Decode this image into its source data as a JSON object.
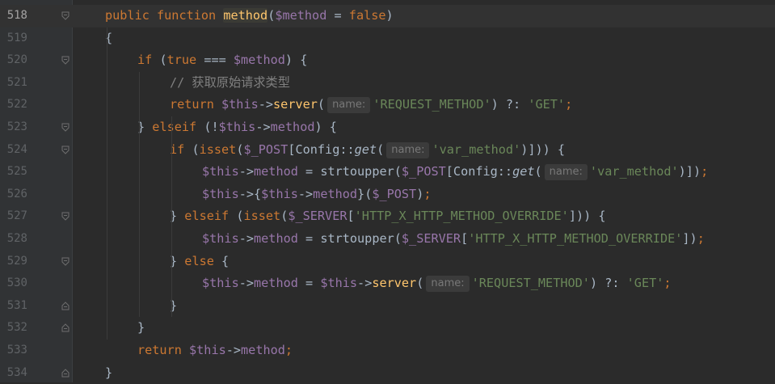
{
  "colors": {
    "background": "#2b2b2b",
    "gutter": "#313335",
    "keyword": "#cc7832",
    "function": "#ffc66d",
    "variable": "#9876aa",
    "string": "#6a8759",
    "comment": "#808080",
    "plain": "#a9b7c6"
  },
  "lines": [
    {
      "num": "518",
      "current": true,
      "fold": "open",
      "tokens": [
        [
          "kw",
          "public "
        ],
        [
          "kw",
          "function "
        ],
        [
          "fn-hl",
          "method"
        ],
        [
          "punct",
          "("
        ],
        [
          "var",
          "$method"
        ],
        [
          "punct",
          " = "
        ],
        [
          "kw",
          "false"
        ],
        [
          "punct",
          ")"
        ]
      ]
    },
    {
      "num": "519",
      "fold": "",
      "tokens": [
        [
          "punct",
          "{"
        ]
      ]
    },
    {
      "num": "520",
      "fold": "open",
      "tokens": [
        [
          "kw",
          "if "
        ],
        [
          "punct",
          "("
        ],
        [
          "kw",
          "true"
        ],
        [
          "punct",
          " === "
        ],
        [
          "var",
          "$method"
        ],
        [
          "punct",
          ") {"
        ]
      ]
    },
    {
      "num": "521",
      "fold": "",
      "tokens": [
        [
          "cmt",
          "// 获取原始请求类型"
        ]
      ]
    },
    {
      "num": "522",
      "fold": "",
      "tokens": [
        [
          "kw",
          "return "
        ],
        [
          "var",
          "$this"
        ],
        [
          "punct",
          "->"
        ],
        [
          "fn",
          "server"
        ],
        [
          "punct",
          "("
        ],
        [
          "hint",
          "name:"
        ],
        [
          "str",
          "'REQUEST_METHOD'"
        ],
        [
          "punct",
          ") ?: "
        ],
        [
          "str",
          "'GET'"
        ],
        [
          "kw",
          ";"
        ]
      ]
    },
    {
      "num": "523",
      "fold": "open",
      "tokens": [
        [
          "punct",
          "} "
        ],
        [
          "kw",
          "elseif "
        ],
        [
          "punct",
          "(!"
        ],
        [
          "var",
          "$this"
        ],
        [
          "punct",
          "->"
        ],
        [
          "var",
          "method"
        ],
        [
          "punct",
          ") {"
        ]
      ]
    },
    {
      "num": "524",
      "fold": "open",
      "tokens": [
        [
          "kw",
          "if "
        ],
        [
          "punct",
          "("
        ],
        [
          "kw",
          "isset"
        ],
        [
          "punct",
          "("
        ],
        [
          "var",
          "$_POST"
        ],
        [
          "punct",
          "[Config::"
        ],
        [
          "ital",
          "get"
        ],
        [
          "punct",
          "("
        ],
        [
          "hint",
          "name:"
        ],
        [
          "str",
          "'var_method'"
        ],
        [
          "punct",
          ")])) {"
        ]
      ]
    },
    {
      "num": "525",
      "fold": "",
      "tokens": [
        [
          "var",
          "$this"
        ],
        [
          "punct",
          "->"
        ],
        [
          "var",
          "method"
        ],
        [
          "punct",
          " = strtoupper("
        ],
        [
          "var",
          "$_POST"
        ],
        [
          "punct",
          "[Config::"
        ],
        [
          "ital",
          "get"
        ],
        [
          "punct",
          "("
        ],
        [
          "hint",
          "name:"
        ],
        [
          "str",
          "'var_method'"
        ],
        [
          "punct",
          ")])"
        ],
        [
          "kw",
          ";"
        ]
      ]
    },
    {
      "num": "526",
      "fold": "",
      "tokens": [
        [
          "var",
          "$this"
        ],
        [
          "punct",
          "->{"
        ],
        [
          "var",
          "$this"
        ],
        [
          "punct",
          "->"
        ],
        [
          "var",
          "method"
        ],
        [
          "punct",
          "}("
        ],
        [
          "var",
          "$_POST"
        ],
        [
          "punct",
          ")"
        ],
        [
          "kw",
          ";"
        ]
      ]
    },
    {
      "num": "527",
      "fold": "open",
      "tokens": [
        [
          "punct",
          "} "
        ],
        [
          "kw",
          "elseif "
        ],
        [
          "punct",
          "("
        ],
        [
          "kw",
          "isset"
        ],
        [
          "punct",
          "("
        ],
        [
          "var",
          "$_SERVER"
        ],
        [
          "punct",
          "["
        ],
        [
          "str",
          "'HTTP_X_HTTP_METHOD_OVERRIDE'"
        ],
        [
          "punct",
          "])) {"
        ]
      ]
    },
    {
      "num": "528",
      "fold": "",
      "tokens": [
        [
          "var",
          "$this"
        ],
        [
          "punct",
          "->"
        ],
        [
          "var",
          "method"
        ],
        [
          "punct",
          " = strtoupper("
        ],
        [
          "var",
          "$_SERVER"
        ],
        [
          "punct",
          "["
        ],
        [
          "str",
          "'HTTP_X_HTTP_METHOD_OVERRIDE'"
        ],
        [
          "punct",
          "])"
        ],
        [
          "kw",
          ";"
        ]
      ]
    },
    {
      "num": "529",
      "fold": "open",
      "tokens": [
        [
          "punct",
          "} "
        ],
        [
          "kw",
          "else "
        ],
        [
          "punct",
          "{"
        ]
      ]
    },
    {
      "num": "530",
      "fold": "",
      "tokens": [
        [
          "var",
          "$this"
        ],
        [
          "punct",
          "->"
        ],
        [
          "var",
          "method"
        ],
        [
          "punct",
          " = "
        ],
        [
          "var",
          "$this"
        ],
        [
          "punct",
          "->"
        ],
        [
          "fn",
          "server"
        ],
        [
          "punct",
          "("
        ],
        [
          "hint",
          "name:"
        ],
        [
          "str",
          "'REQUEST_METHOD'"
        ],
        [
          "punct",
          ") ?: "
        ],
        [
          "str",
          "'GET'"
        ],
        [
          "kw",
          ";"
        ]
      ]
    },
    {
      "num": "531",
      "fold": "close",
      "tokens": [
        [
          "punct",
          "}"
        ]
      ]
    },
    {
      "num": "532",
      "fold": "close",
      "tokens": [
        [
          "punct",
          "}"
        ]
      ]
    },
    {
      "num": "533",
      "fold": "",
      "tokens": [
        [
          "kw",
          "return "
        ],
        [
          "var",
          "$this"
        ],
        [
          "punct",
          "->"
        ],
        [
          "var",
          "method"
        ],
        [
          "kw",
          ";"
        ]
      ]
    },
    {
      "num": "534",
      "fold": "close",
      "tokens": [
        [
          "punct",
          "}"
        ]
      ]
    }
  ]
}
